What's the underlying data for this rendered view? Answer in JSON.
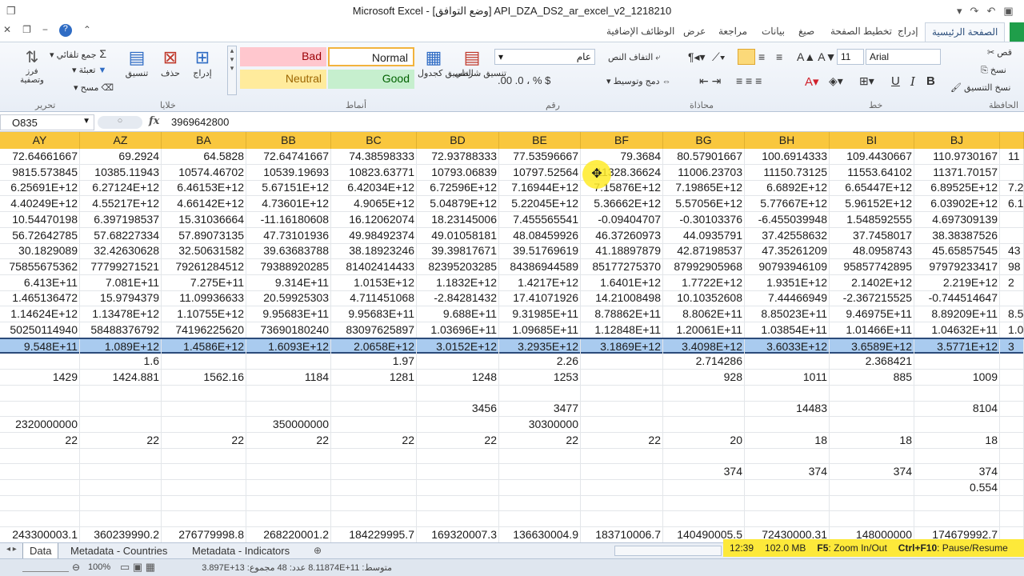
{
  "window": {
    "title": "Microsoft Excel - [وضع التوافق]  API_DZA_DS2_ar_excel_v2_1218210"
  },
  "ribbon_tabs": [
    "الصفحة الرئيسية",
    "إدراج",
    "تخطيط الصفحة",
    "صيغ",
    "بيانات",
    "مراجعة",
    "عرض",
    "الوظائف الإضافية"
  ],
  "ribbon": {
    "groups": [
      "الحافظة",
      "خط",
      "محاذاة",
      "رقم",
      "أنماط",
      "خلايا",
      "تحرير"
    ],
    "clipboard": {
      "cut": "قص",
      "copy": "نسخ",
      "format_painter": "نسخ التنسيق"
    },
    "font": {
      "name": "Arial",
      "size": "11"
    },
    "alignment": {
      "wrap": "التفاف النص",
      "merge": "دمج وتوسيط"
    },
    "number": {
      "format": "عام"
    },
    "styles": {
      "conditional": "تنسيق شرطي",
      "as_table": "التنسيق كجدول",
      "normal": "Normal",
      "bad": "Bad",
      "good": "Good",
      "neutral": "Neutral"
    },
    "cells": {
      "insert": "إدراج",
      "delete": "حذف",
      "format": "تنسيق"
    },
    "editing": {
      "autosum": "جمع تلقائي",
      "fill": "تعبئة",
      "clear": "مسح",
      "sort_filter": "فرز وتصفية"
    }
  },
  "formula_bar": {
    "name_box": "O835",
    "fx": "fx",
    "value": "3969642800"
  },
  "columns": [
    "AY",
    "AZ",
    "BA",
    "BB",
    "BC",
    "BD",
    "BE",
    "BF",
    "BG",
    "BH",
    "BI",
    "BJ"
  ],
  "rows": [
    [
      "72.64661667",
      "69.2924",
      "64.5828",
      "72.64741667",
      "74.38598333",
      "72.93788333",
      "77.53596667",
      "79.3684",
      "80.57901667",
      "100.6914333",
      "109.4430667",
      "110.9730167"
    ],
    [
      "9815.573845",
      "10385.11943",
      "10574.46702",
      "10539.19693",
      "10823.63771",
      "10793.06839",
      "10797.52564",
      "11328.36624",
      "11006.23703",
      "11150.73125",
      "11553.64102",
      "11371.70157"
    ],
    [
      "6.25691E+12",
      "6.27124E+12",
      "6.46153E+12",
      "5.67151E+12",
      "6.42034E+12",
      "6.72596E+12",
      "7.16944E+12",
      "7.15876E+12",
      "7.19865E+12",
      "6.6892E+12",
      "6.65447E+12",
      "6.89525E+12"
    ],
    [
      "4.40249E+12",
      "4.55217E+12",
      "4.66142E+12",
      "4.73601E+12",
      "4.9065E+12",
      "5.04879E+12",
      "5.22045E+12",
      "5.36662E+12",
      "5.57056E+12",
      "5.77667E+12",
      "5.96152E+12",
      "6.03902E+12"
    ],
    [
      "10.54470198",
      "6.397198537",
      "15.31036664",
      "-11.16180608",
      "16.12062074",
      "18.23145006",
      "7.455565541",
      "-0.09404707",
      "-0.30103376",
      "-6.455039948",
      "1.548592555",
      "4.697309139"
    ],
    [
      "56.72642785",
      "57.68227334",
      "57.89073135",
      "47.73101936",
      "49.98492374",
      "49.01058181",
      "48.08459926",
      "46.37260973",
      "44.0935791",
      "37.42558632",
      "37.7458017",
      "38.38387526"
    ],
    [
      "30.1829089",
      "32.42630628",
      "32.50631582",
      "39.63683788",
      "38.18923246",
      "39.39817671",
      "39.51769619",
      "41.18897879",
      "42.87198537",
      "47.35261209",
      "48.0958743",
      "45.65857545"
    ],
    [
      "75855675362",
      "77799271521",
      "79261284512",
      "79388920285",
      "81402414433",
      "82395203285",
      "84386944589",
      "85177275370",
      "87992905968",
      "90793946109",
      "95857742895",
      "97979233417"
    ],
    [
      "6.413E+11",
      "7.081E+11",
      "7.275E+11",
      "9.314E+11",
      "1.0153E+12",
      "1.1832E+12",
      "1.4217E+12",
      "1.6401E+12",
      "1.7722E+12",
      "1.9351E+12",
      "2.1402E+12",
      "2.219E+12"
    ],
    [
      "1.465136472",
      "15.9794379",
      "11.09936633",
      "20.59925303",
      "4.711451068",
      "-2.84281432",
      "17.41071926",
      "14.21008498",
      "10.10352608",
      "7.44466949",
      "-2.367215525",
      "-0.744514647"
    ],
    [
      "1.14624E+12",
      "1.13478E+12",
      "1.10755E+12",
      "9.95683E+11",
      "9.95683E+11",
      "9.688E+11",
      "9.31985E+11",
      "8.78862E+11",
      "8.8062E+11",
      "8.85023E+11",
      "9.46975E+11",
      "8.89209E+11"
    ],
    [
      "50250114940",
      "58488376792",
      "74196225620",
      "73690180240",
      "83097625897",
      "1.03696E+11",
      "1.09685E+11",
      "1.12848E+11",
      "1.20061E+11",
      "1.03854E+11",
      "1.01466E+11",
      "1.04632E+11"
    ],
    [
      "9.548E+11",
      "1.089E+12",
      "1.4586E+12",
      "1.6093E+12",
      "2.0658E+12",
      "3.0152E+12",
      "3.2935E+12",
      "3.1869E+12",
      "3.4098E+12",
      "3.6033E+12",
      "3.6589E+12",
      "3.5771E+12"
    ],
    [
      "",
      "1.6",
      "",
      "",
      "1.97",
      "",
      "2.26",
      "",
      "2.714286",
      "",
      "2.368421",
      ""
    ],
    [
      "1429",
      "1424.881",
      "1562.16",
      "1184",
      "1281",
      "1248",
      "1253",
      "",
      "928",
      "1011",
      "885",
      "1009"
    ],
    [
      "",
      "",
      "",
      "",
      "",
      "",
      "",
      "",
      "",
      "",
      "",
      ""
    ],
    [
      "",
      "",
      "",
      "",
      "",
      "3456",
      "3477",
      "",
      "",
      "14483",
      "",
      "8104"
    ],
    [
      "2320000000",
      "",
      "",
      "350000000",
      "",
      "",
      "30300000",
      "",
      "",
      "",
      "",
      ""
    ],
    [
      "22",
      "22",
      "22",
      "22",
      "22",
      "22",
      "22",
      "22",
      "20",
      "18",
      "18",
      "18"
    ],
    [
      "",
      "",
      "",
      "",
      "",
      "",
      "",
      "",
      "",
      "",
      "",
      ""
    ],
    [
      "",
      "",
      "",
      "",
      "",
      "",
      "",
      "",
      "374",
      "374",
      "374",
      "374"
    ],
    [
      "",
      "",
      "",
      "",
      "",
      "",
      "",
      "",
      "",
      "",
      "",
      "0.554"
    ],
    [
      "",
      "",
      "",
      "",
      "",
      "",
      "",
      "",
      "",
      "",
      "",
      ""
    ],
    [
      "",
      "",
      "",
      "",
      "",
      "",
      "",
      "",
      "",
      "",
      "",
      ""
    ],
    [
      "243300003.1",
      "360239990.2",
      "276779998.8",
      "268220001.2",
      "184229995.7",
      "169320007.3",
      "136630004.9",
      "183710006.7",
      "140490005.5",
      "72430000.31",
      "148000000",
      "174679992.7"
    ]
  ],
  "partial_next_col": [
    "11",
    "",
    "7.2",
    "6.1",
    "",
    "",
    "43",
    "98",
    "2",
    "",
    "8.5",
    "1.0",
    "3"
  ],
  "selected_row_index": 12,
  "sheet_tabs": [
    "Data",
    "Metadata - Countries",
    "Metadata - Indicators"
  ],
  "overlay": {
    "time": "12:39",
    "memory": "102.0 MB",
    "f5": "F5",
    "f5_text": ": Zoom In/Out",
    "ctrl": "Ctrl+F10",
    "ctrl_text": ": Pause/Resume"
  },
  "status_bar": {
    "zoom": "100%",
    "summary": "متوسط: 8.11874E+11   عدد: 48   مجموع: 3.897E+13"
  }
}
